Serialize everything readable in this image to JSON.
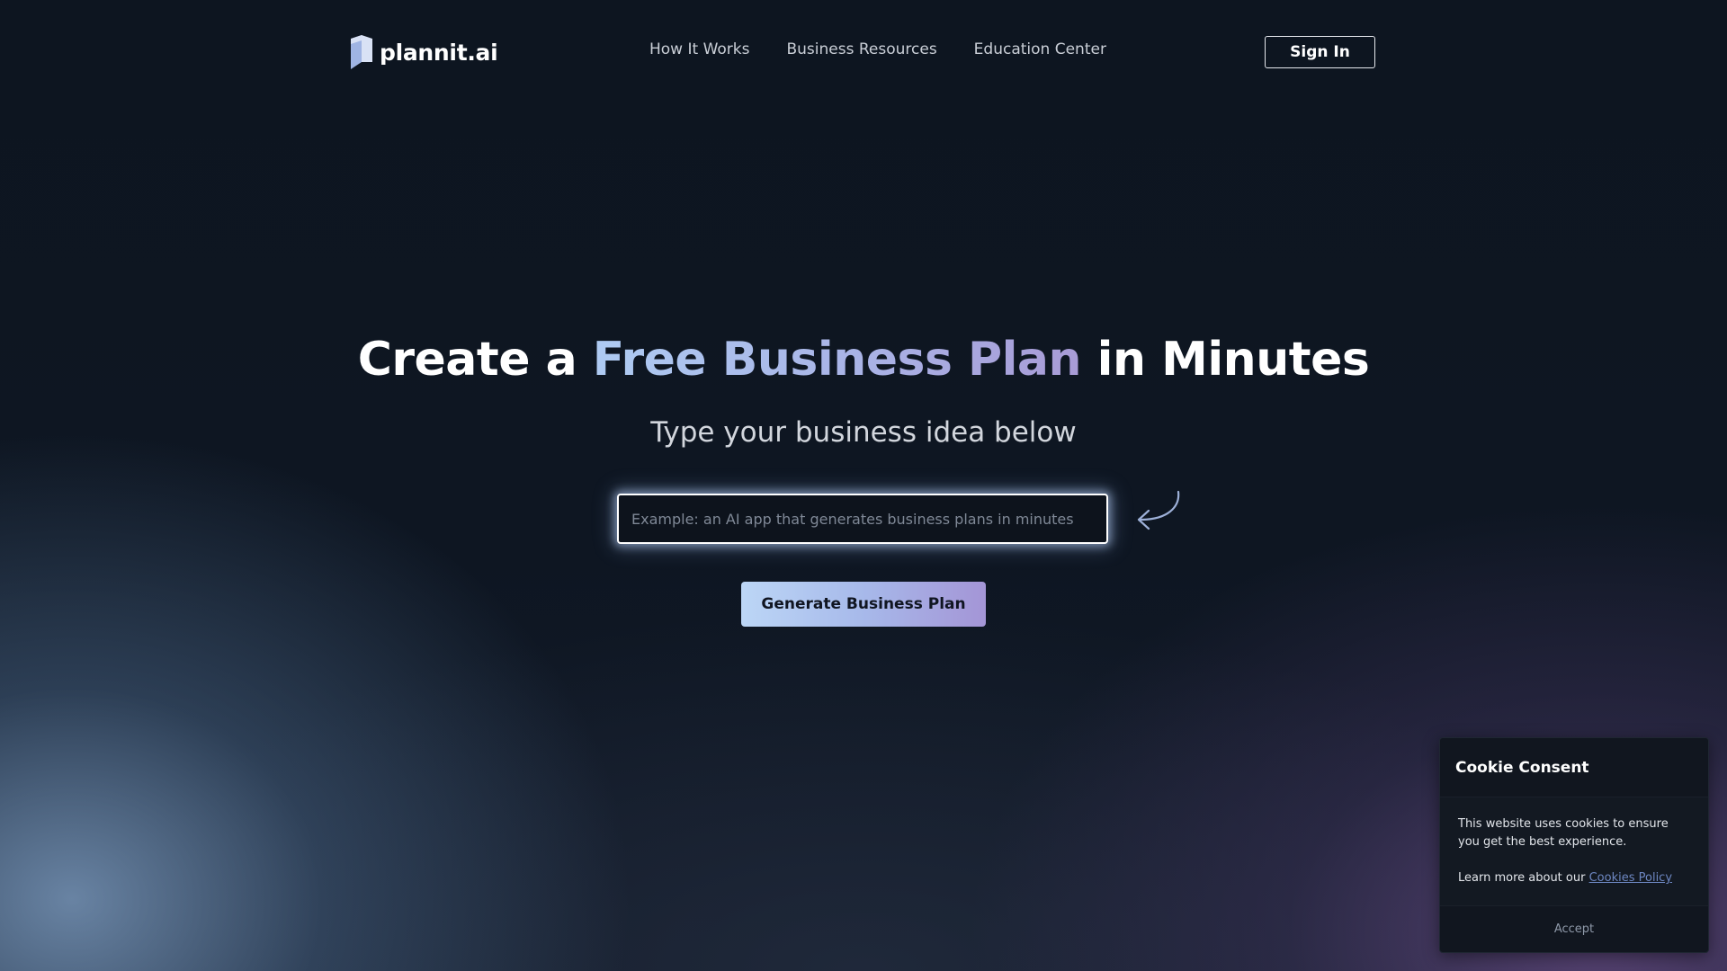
{
  "brand": {
    "name": "plannit.ai",
    "logo_icon": "book-logo-icon"
  },
  "nav": {
    "links": [
      "How It Works",
      "Business Resources",
      "Education Center"
    ],
    "sign_in_label": "Sign In"
  },
  "hero": {
    "title_before": "Create a ",
    "title_accent": "Free Business Plan",
    "title_after": " in Minutes",
    "subtitle": "Type your business idea below",
    "input_value": "",
    "input_placeholder": "Example: an AI app that generates business plans in minutes",
    "arrow_icon": "curved-arrow-icon",
    "cta_label": "Generate Business Plan"
  },
  "cookie": {
    "title": "Cookie Consent",
    "message": "This website uses cookies to ensure you get the best experience.",
    "learn_more_prefix": "Learn more about our ",
    "policy_link": "Cookies Policy",
    "accept_label": "Accept"
  },
  "colors": {
    "background": "#0d1520",
    "accent_gradient_start": "#aecbf2",
    "accent_gradient_end": "#a89bd6",
    "cookie_link": "#6d87c2"
  }
}
